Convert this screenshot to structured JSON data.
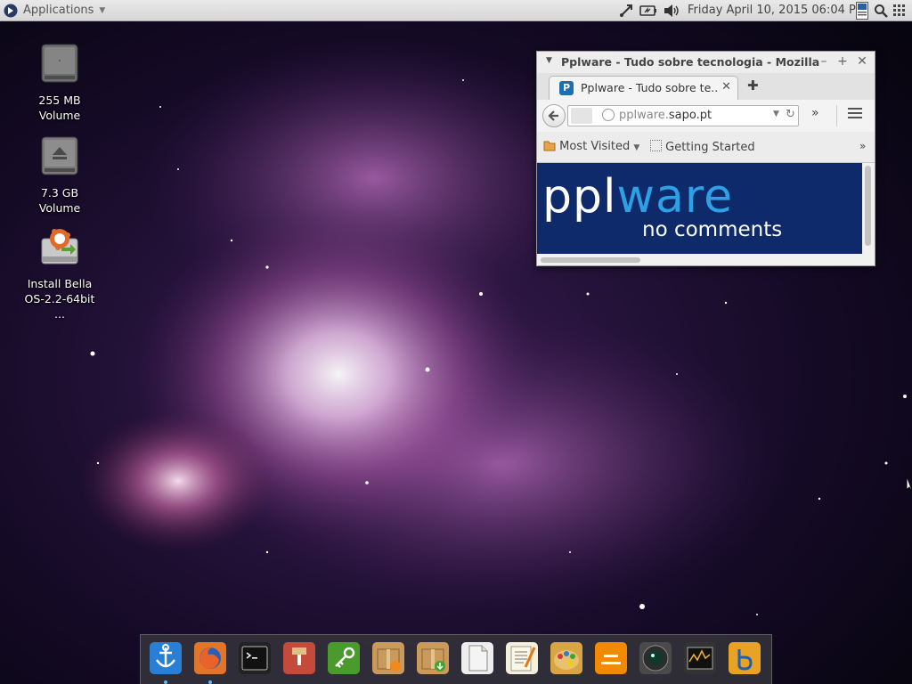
{
  "top_panel": {
    "applications_label": "Applications",
    "clock": "Friday April 10, 2015 06:04 PM"
  },
  "desktop_icons": [
    {
      "label": "255 MB Volume",
      "icon": "hard-drive-icon"
    },
    {
      "label": "7.3 GB Volume",
      "icon": "removable-drive-icon"
    },
    {
      "label": "Install Bella OS-2.2-64bit ...",
      "icon": "installer-icon"
    }
  ],
  "browser": {
    "window_title": "Pplware - Tudo sobre tecnologia - Mozilla",
    "tab_title": "Pplware - Tudo sobre te...",
    "url_dim": "pplware.",
    "url_host": "sapo.pt",
    "bookmarks": [
      "Most Visited",
      "Getting Started"
    ],
    "banner_logo_ppl": "ppl",
    "banner_logo_ware": "ware",
    "banner_tagline": "no comments"
  },
  "dock": {
    "items": [
      {
        "name": "Dock Anchor",
        "icon": "anchor-icon",
        "color": "#2a7fd4",
        "active": true
      },
      {
        "name": "Firefox",
        "icon": "firefox-icon",
        "color": "#e0762a",
        "active": true
      },
      {
        "name": "Terminal",
        "icon": "terminal-icon",
        "color": "#222222",
        "active": false
      },
      {
        "name": "Archive Manager",
        "icon": "archive-icon",
        "color": "#c44a3c",
        "active": false
      },
      {
        "name": "Passwords and Keys",
        "icon": "key-icon",
        "color": "#4a9a2e",
        "active": false
      },
      {
        "name": "Software Updater",
        "icon": "package-update-icon",
        "color": "#c99a5c",
        "active": false
      },
      {
        "name": "Package Installer",
        "icon": "package-install-icon",
        "color": "#c99a5c",
        "active": false
      },
      {
        "name": "Document Viewer",
        "icon": "document-icon",
        "color": "#eeeeee",
        "active": false
      },
      {
        "name": "Text Editor",
        "icon": "text-editor-icon",
        "color": "#f4f0dc",
        "active": false
      },
      {
        "name": "Paint",
        "icon": "paint-icon",
        "color": "#d8a545",
        "active": false
      },
      {
        "name": "VLC Media Player",
        "icon": "vlc-icon",
        "color": "#f08a00",
        "active": false
      },
      {
        "name": "Cheese Webcam",
        "icon": "webcam-icon",
        "color": "#4a4a4a",
        "active": false
      },
      {
        "name": "System Monitor",
        "icon": "system-monitor-icon",
        "color": "#333333",
        "active": false
      },
      {
        "name": "Bella OS",
        "icon": "bella-icon",
        "color": "#e8a325",
        "active": false
      }
    ]
  }
}
